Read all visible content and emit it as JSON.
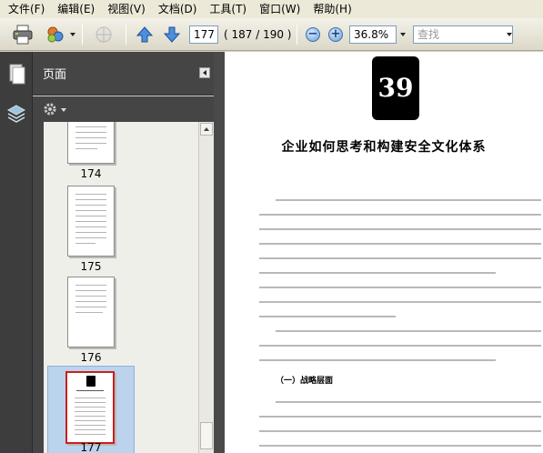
{
  "menu": [
    "文件(F)",
    "编辑(E)",
    "视图(V)",
    "文档(D)",
    "工具(T)",
    "窗口(W)",
    "帮助(H)"
  ],
  "toolbar": {
    "page_value": "177",
    "page_total": "( 187 / 190 )",
    "zoom_value": "36.8%",
    "search_placeholder": "查找"
  },
  "panel": {
    "title": "页面"
  },
  "thumbnails": [
    {
      "label": "174",
      "selected": false
    },
    {
      "label": "175",
      "selected": false
    },
    {
      "label": "176",
      "selected": false
    },
    {
      "label": "177",
      "selected": true
    }
  ],
  "document": {
    "chapter_number": "39",
    "title": "企业如何思考和构建安全文化体系",
    "section_heading": "（一）战略层面"
  },
  "colors": {
    "selection": "#bcd3ee",
    "accent": "#cc1f1f",
    "doc_bg": "#ffffff"
  }
}
